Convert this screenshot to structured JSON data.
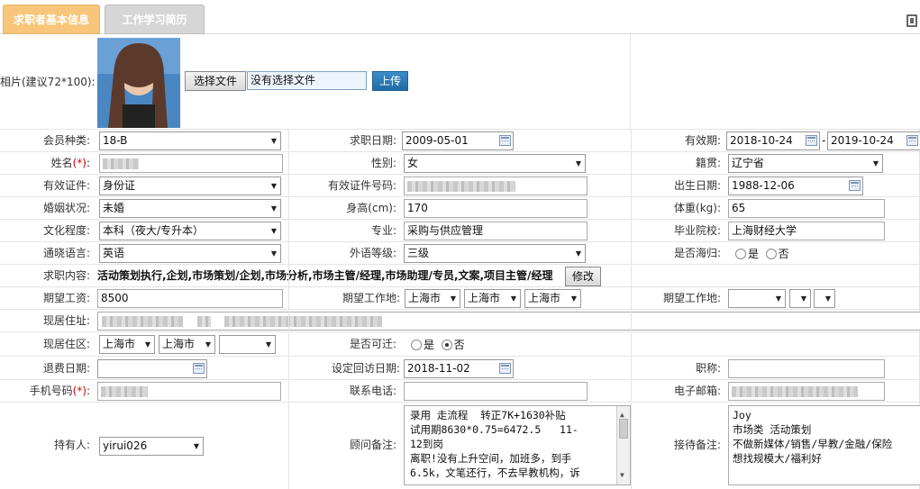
{
  "tabs": {
    "active": "求职者基本信息",
    "inactive": "工作学习简历"
  },
  "photo": {
    "label": "相片(建议72*100):",
    "choose_btn": "选择文件",
    "file_status": "没有选择文件",
    "upload_btn": "上传"
  },
  "row1": {
    "member_label": "会员种类:",
    "member_value": "18-B",
    "apply_date_label": "求职日期:",
    "apply_date": "2009-05-01",
    "valid_label": "有效期:",
    "valid_from": "2018-10-24",
    "dash": "-",
    "valid_to": "2019-10-24"
  },
  "row2": {
    "name_label": "姓名",
    "req": "(*)",
    "colon": ":",
    "gender_label": "性别:",
    "gender_value": "女",
    "native_label": "籍贯:",
    "native_value": "辽宁省"
  },
  "row3": {
    "id_type_label": "有效证件:",
    "id_type_value": "身份证",
    "id_no_label": "有效证件号码:",
    "birth_label": "出生日期:",
    "birth_value": "1988-12-06"
  },
  "row4": {
    "marital_label": "婚姻状况:",
    "marital_value": "未婚",
    "height_label": "身高(cm):",
    "height_value": "170",
    "weight_label": "体重(kg):",
    "weight_value": "65"
  },
  "row5": {
    "edu_label": "文化程度:",
    "edu_value": "本科（夜大/专升本）",
    "major_label": "专业:",
    "major_value": "采购与供应管理",
    "school_label": "毕业院校:",
    "school_value": "上海财经大学"
  },
  "row6": {
    "lang_label": "通晓语言:",
    "lang_value": "英语",
    "level_label": "外语等级:",
    "level_value": "三级",
    "abroad_label": "是否海归:",
    "yes": "是",
    "no": "否"
  },
  "row7": {
    "job_label": "求职内容:",
    "job_value": "活动策划执行,企划,市场策划/企划,市场分析,市场主管/经理,市场助理/专员,文案,项目主管/经理",
    "edit_btn": "修改"
  },
  "row8": {
    "salary_label": "期望工资:",
    "salary_value": "8500",
    "loc_label": "期望工作地:",
    "loc1": "上海市",
    "loc2": "上海市",
    "loc3": "上海市",
    "loc2_label": "期望工作地:"
  },
  "row9": {
    "addr_label": "现居住址:"
  },
  "row10": {
    "area_label": "现居住区:",
    "area1": "上海市",
    "area2": "上海市",
    "relocate_label": "是否可迁:",
    "yes": "是",
    "no": "否"
  },
  "row11": {
    "back_date_label": "退费日期:",
    "revisit_label": "设定回访日期:",
    "revisit_value": "2018-11-02",
    "title_label": "职称:"
  },
  "row12": {
    "mobile_label": "手机号码",
    "req": "(*)",
    "colon": ":",
    "phone_label": "联系电话:",
    "email_label": "电子邮箱:"
  },
  "row13": {
    "owner_label": "持有人:",
    "owner_value": "yirui026",
    "consultant_label": "顾问备注:",
    "consultant_note": "录用 走流程  转正7K+1630补贴\n试用期8630*0.75=6472.5   11-\n12到岗\n离职!没有上升空间，加班多，到手\n6.5k，文笔还行，不去早教机构，诉",
    "reception_label": "接待备注:",
    "reception_note": "Joy\n市场类 活动策划\n不做新媒体/销售/早教/金融/保险\n想找规模大/福利好"
  }
}
